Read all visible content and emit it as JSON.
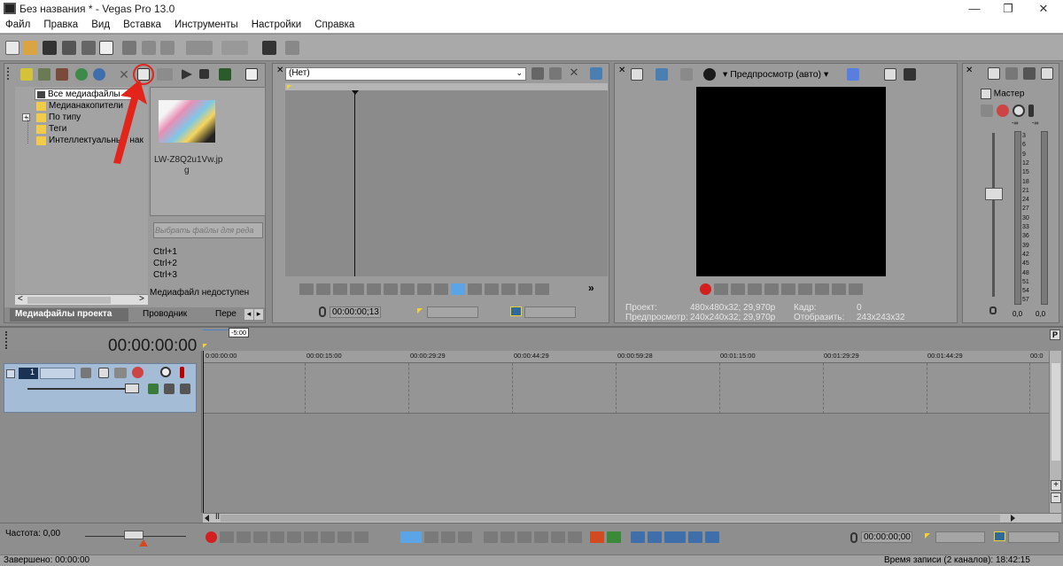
{
  "window": {
    "title": "Без названия * - Vegas Pro 13.0",
    "minimize": "—",
    "maximize": "❐",
    "close": "✕"
  },
  "menu": [
    "Файл",
    "Правка",
    "Вид",
    "Вставка",
    "Инструменты",
    "Настройки",
    "Справка"
  ],
  "explorer": {
    "tree": [
      {
        "label": "Все медиафайлы",
        "selected": true
      },
      {
        "label": "Медианакопители"
      },
      {
        "label": "По типу",
        "expander": "+"
      },
      {
        "label": "Теги"
      },
      {
        "label": "Интеллектуальные нак"
      }
    ],
    "thumb_name_1": "LW-Z8Q2u1Vw.jp",
    "thumb_name_2": "g",
    "search_placeholder": "Выбрать файлы для реда",
    "shortcuts": [
      "Ctrl+1",
      "Ctrl+2",
      "Ctrl+3"
    ],
    "status": "Медиафайл недоступен",
    "scroll_left": "<",
    "scroll_right": ">",
    "tabs": [
      "Медиафайлы проекта",
      "Проводник",
      "Пере"
    ],
    "tab_prev": "◂",
    "tab_next": "▸"
  },
  "trimmer": {
    "dropdown": "(Нет)",
    "timecode": "00:00:00;13",
    "more": "»"
  },
  "preview": {
    "mode_label": "Предпросмотр (авто)",
    "project_label": "Проект:",
    "project_value": "480x480x32; 29,970p",
    "preview_label": "Предпросмотр:",
    "preview_value": "240x240x32; 29,970p",
    "frame_label": "Кадр:",
    "frame_value": "0",
    "display_label": "Отобразить:",
    "display_value": "243x243x32"
  },
  "master": {
    "label": "Мастер",
    "inf_left": "-∞",
    "inf_right": "-∞",
    "scale": [
      "3",
      "6",
      "9",
      "12",
      "15",
      "18",
      "21",
      "24",
      "27",
      "30",
      "33",
      "36",
      "39",
      "42",
      "45",
      "48",
      "51",
      "54",
      "57"
    ],
    "value_left": "0,0",
    "value_right": "0,0"
  },
  "timeline": {
    "timecode": "00:00:00;00",
    "marker": "-5:00",
    "ticks": [
      "0:00:00:00",
      "00:00:15:00",
      "00:00:29:29",
      "00:00:44:29",
      "00:00:59:28",
      "00:01:15:00",
      "00:01:29:29",
      "00:01:44:29",
      "00:0"
    ],
    "track_number": "1",
    "rate_label": "Частота: 0,00",
    "cursor_tc": "00:00:00;00",
    "scroll_marker": "II",
    "side_letter": "P",
    "zoom_in": "+",
    "zoom_out": "−"
  },
  "statusbar": {
    "left": "Завершено: 00:00:00",
    "right": "Время записи (2 каналов): 18:42:15"
  },
  "colors": {
    "accent": "#5ba4e6",
    "track_header": "#a5bcd6",
    "record": "#d22020",
    "annotation_arrow": "#e3241b"
  }
}
